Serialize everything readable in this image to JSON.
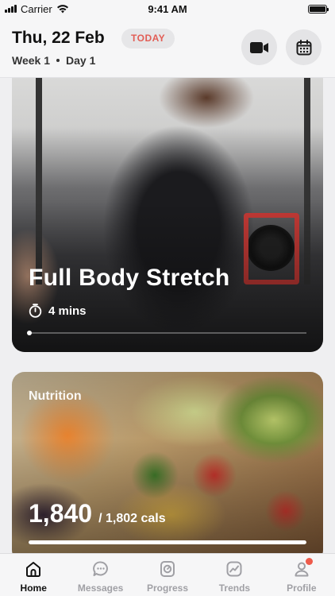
{
  "status_bar": {
    "carrier": "Carrier",
    "time": "9:41 AM"
  },
  "header": {
    "date": "Thu, 22 Feb",
    "today_badge": "TODAY",
    "week": "Week 1",
    "day": "Day 1"
  },
  "workout_card": {
    "title": "Full Body Stretch",
    "duration": "4 mins"
  },
  "nutrition_card": {
    "label": "Nutrition",
    "calories_consumed": "1,840",
    "calories_goal": "/ 1,802 cals",
    "progress": 1.0
  },
  "tabs": [
    {
      "label": "Home",
      "icon": "home-icon",
      "active": true
    },
    {
      "label": "Messages",
      "icon": "messages-icon",
      "active": false
    },
    {
      "label": "Progress",
      "icon": "progress-icon",
      "active": false
    },
    {
      "label": "Trends",
      "icon": "trends-icon",
      "active": false
    },
    {
      "label": "Profile",
      "icon": "profile-icon",
      "active": false
    }
  ],
  "colors": {
    "accent": "#e25d55",
    "notification": "#ee5b4b",
    "tab_active": "#111111",
    "tab_inactive": "#a0a0a5"
  }
}
